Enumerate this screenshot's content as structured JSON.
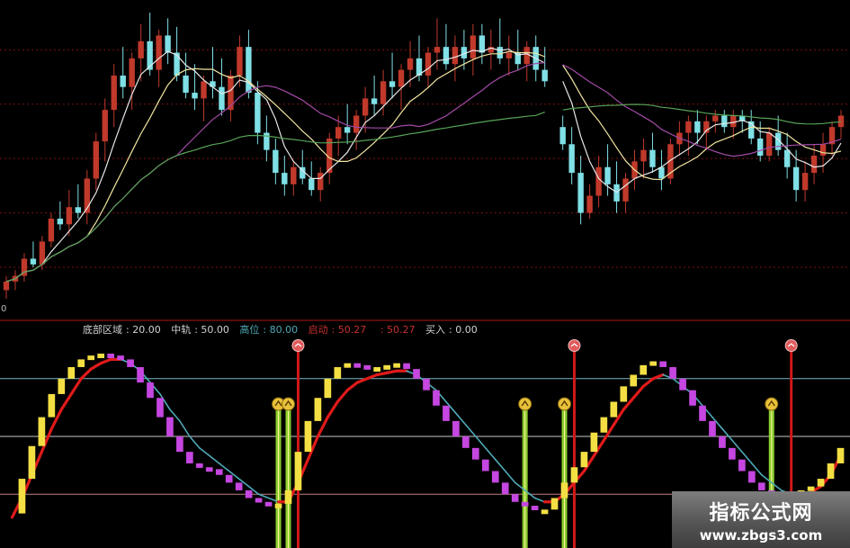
{
  "top_labels": [
    "",
    "",
    ""
  ],
  "axis": {
    "zero_label": "0"
  },
  "legend": [
    {
      "label": "底部区域",
      "value": "20.00",
      "color": "#d2d2d2"
    },
    {
      "label": "中轨",
      "value": "50.00",
      "color": "#d2d2d2"
    },
    {
      "label": "高位",
      "value": "80.00",
      "color": "#4fa9b8"
    },
    {
      "label": "启动",
      "value": "50.27",
      "color": "#c83030"
    },
    {
      "label": "",
      "value": "50.27",
      "color": "#c83030"
    },
    {
      "label": "买入",
      "value": "0.00",
      "color": "#d2d2d2"
    }
  ],
  "watermark": {
    "title": "指标公式网",
    "url": "www.zbgs3.com"
  },
  "colors": {
    "background": "#000000",
    "up_candle": "#c0392b",
    "down_candle": "#7fe0e6",
    "ma5": "#e8e8e8",
    "ma10": "#f1e6a0",
    "ma20": "#a24aa6",
    "ma60": "#56a356",
    "kd_fast_up": "#f3df43",
    "kd_fast_down": "#c546e0",
    "kd_slow_up": "#e01a1a",
    "kd_slow_down": "#4fa9b8",
    "buy_bar": "#8ccc2e",
    "sell_bar": "#d01818",
    "buy_marker": "#e7c23a",
    "sell_marker": "#e05a5a"
  },
  "chart_data": [
    {
      "type": "candlestick",
      "title": "",
      "ylim": [
        0,
        100
      ],
      "note": "Upper panel: daily candles with moving averages; a gap in the data after bar 60.",
      "candles": [
        {
          "o": 3,
          "h": 8,
          "l": 0,
          "c": 6
        },
        {
          "o": 6,
          "h": 10,
          "l": 3,
          "c": 8
        },
        {
          "o": 8,
          "h": 16,
          "l": 6,
          "c": 14
        },
        {
          "o": 14,
          "h": 20,
          "l": 11,
          "c": 12
        },
        {
          "o": 12,
          "h": 22,
          "l": 10,
          "c": 20
        },
        {
          "o": 20,
          "h": 30,
          "l": 18,
          "c": 28
        },
        {
          "o": 28,
          "h": 34,
          "l": 24,
          "c": 26
        },
        {
          "o": 26,
          "h": 38,
          "l": 22,
          "c": 32
        },
        {
          "o": 32,
          "h": 40,
          "l": 28,
          "c": 30
        },
        {
          "o": 30,
          "h": 45,
          "l": 26,
          "c": 42
        },
        {
          "o": 42,
          "h": 58,
          "l": 38,
          "c": 55
        },
        {
          "o": 55,
          "h": 70,
          "l": 48,
          "c": 66
        },
        {
          "o": 66,
          "h": 82,
          "l": 60,
          "c": 78
        },
        {
          "o": 78,
          "h": 88,
          "l": 70,
          "c": 74
        },
        {
          "o": 74,
          "h": 86,
          "l": 66,
          "c": 84
        },
        {
          "o": 84,
          "h": 96,
          "l": 76,
          "c": 90
        },
        {
          "o": 90,
          "h": 100,
          "l": 78,
          "c": 80
        },
        {
          "o": 80,
          "h": 94,
          "l": 74,
          "c": 92
        },
        {
          "o": 92,
          "h": 98,
          "l": 82,
          "c": 86
        },
        {
          "o": 86,
          "h": 95,
          "l": 76,
          "c": 78
        },
        {
          "o": 78,
          "h": 86,
          "l": 70,
          "c": 72
        },
        {
          "o": 72,
          "h": 82,
          "l": 66,
          "c": 70
        },
        {
          "o": 70,
          "h": 78,
          "l": 62,
          "c": 76
        },
        {
          "o": 76,
          "h": 88,
          "l": 70,
          "c": 74
        },
        {
          "o": 74,
          "h": 84,
          "l": 64,
          "c": 66
        },
        {
          "o": 66,
          "h": 80,
          "l": 62,
          "c": 78
        },
        {
          "o": 78,
          "h": 92,
          "l": 74,
          "c": 88
        },
        {
          "o": 88,
          "h": 94,
          "l": 70,
          "c": 72
        },
        {
          "o": 72,
          "h": 76,
          "l": 54,
          "c": 58
        },
        {
          "o": 58,
          "h": 64,
          "l": 48,
          "c": 52
        },
        {
          "o": 52,
          "h": 56,
          "l": 40,
          "c": 44
        },
        {
          "o": 44,
          "h": 50,
          "l": 36,
          "c": 40
        },
        {
          "o": 40,
          "h": 48,
          "l": 36,
          "c": 46
        },
        {
          "o": 46,
          "h": 52,
          "l": 40,
          "c": 42
        },
        {
          "o": 42,
          "h": 48,
          "l": 36,
          "c": 38
        },
        {
          "o": 38,
          "h": 46,
          "l": 34,
          "c": 44
        },
        {
          "o": 44,
          "h": 58,
          "l": 40,
          "c": 56
        },
        {
          "o": 56,
          "h": 64,
          "l": 50,
          "c": 60
        },
        {
          "o": 60,
          "h": 68,
          "l": 54,
          "c": 58
        },
        {
          "o": 58,
          "h": 66,
          "l": 52,
          "c": 64
        },
        {
          "o": 64,
          "h": 74,
          "l": 58,
          "c": 70
        },
        {
          "o": 70,
          "h": 78,
          "l": 64,
          "c": 68
        },
        {
          "o": 68,
          "h": 80,
          "l": 64,
          "c": 76
        },
        {
          "o": 76,
          "h": 86,
          "l": 70,
          "c": 74
        },
        {
          "o": 74,
          "h": 82,
          "l": 66,
          "c": 80
        },
        {
          "o": 80,
          "h": 90,
          "l": 74,
          "c": 84
        },
        {
          "o": 84,
          "h": 92,
          "l": 76,
          "c": 78
        },
        {
          "o": 78,
          "h": 88,
          "l": 74,
          "c": 86
        },
        {
          "o": 86,
          "h": 98,
          "l": 80,
          "c": 88
        },
        {
          "o": 88,
          "h": 96,
          "l": 80,
          "c": 82
        },
        {
          "o": 82,
          "h": 92,
          "l": 76,
          "c": 88
        },
        {
          "o": 88,
          "h": 94,
          "l": 80,
          "c": 84
        },
        {
          "o": 84,
          "h": 96,
          "l": 78,
          "c": 92
        },
        {
          "o": 92,
          "h": 96,
          "l": 82,
          "c": 86
        },
        {
          "o": 86,
          "h": 94,
          "l": 80,
          "c": 88
        },
        {
          "o": 88,
          "h": 98,
          "l": 82,
          "c": 84
        },
        {
          "o": 84,
          "h": 92,
          "l": 78,
          "c": 86
        },
        {
          "o": 86,
          "h": 94,
          "l": 80,
          "c": 82
        },
        {
          "o": 82,
          "h": 90,
          "l": 76,
          "c": 88
        },
        {
          "o": 88,
          "h": 92,
          "l": 76,
          "c": 80
        },
        {
          "o": 80,
          "h": 88,
          "l": 74,
          "c": 76
        },
        {
          "o": 60,
          "h": 64,
          "l": 52,
          "c": 54
        },
        {
          "o": 54,
          "h": 60,
          "l": 40,
          "c": 44
        },
        {
          "o": 44,
          "h": 50,
          "l": 26,
          "c": 30
        },
        {
          "o": 30,
          "h": 40,
          "l": 28,
          "c": 36
        },
        {
          "o": 36,
          "h": 50,
          "l": 32,
          "c": 46
        },
        {
          "o": 46,
          "h": 54,
          "l": 36,
          "c": 40
        },
        {
          "o": 40,
          "h": 48,
          "l": 30,
          "c": 34
        },
        {
          "o": 34,
          "h": 44,
          "l": 30,
          "c": 42
        },
        {
          "o": 42,
          "h": 52,
          "l": 38,
          "c": 48
        },
        {
          "o": 48,
          "h": 56,
          "l": 42,
          "c": 52
        },
        {
          "o": 52,
          "h": 58,
          "l": 44,
          "c": 46
        },
        {
          "o": 46,
          "h": 52,
          "l": 38,
          "c": 42
        },
        {
          "o": 42,
          "h": 56,
          "l": 40,
          "c": 54
        },
        {
          "o": 54,
          "h": 62,
          "l": 50,
          "c": 58
        },
        {
          "o": 58,
          "h": 64,
          "l": 50,
          "c": 62
        },
        {
          "o": 62,
          "h": 66,
          "l": 54,
          "c": 58
        },
        {
          "o": 58,
          "h": 64,
          "l": 52,
          "c": 62
        },
        {
          "o": 62,
          "h": 66,
          "l": 58,
          "c": 64
        },
        {
          "o": 64,
          "h": 66,
          "l": 58,
          "c": 60
        },
        {
          "o": 60,
          "h": 66,
          "l": 56,
          "c": 64
        },
        {
          "o": 64,
          "h": 66,
          "l": 58,
          "c": 62
        },
        {
          "o": 62,
          "h": 66,
          "l": 54,
          "c": 56
        },
        {
          "o": 56,
          "h": 62,
          "l": 48,
          "c": 50
        },
        {
          "o": 50,
          "h": 60,
          "l": 48,
          "c": 58
        },
        {
          "o": 58,
          "h": 64,
          "l": 50,
          "c": 52
        },
        {
          "o": 52,
          "h": 58,
          "l": 42,
          "c": 46
        },
        {
          "o": 46,
          "h": 52,
          "l": 34,
          "c": 38
        },
        {
          "o": 38,
          "h": 48,
          "l": 34,
          "c": 44
        },
        {
          "o": 44,
          "h": 54,
          "l": 40,
          "c": 50
        },
        {
          "o": 50,
          "h": 58,
          "l": 44,
          "c": 54
        },
        {
          "o": 54,
          "h": 62,
          "l": 50,
          "c": 60
        },
        {
          "o": 60,
          "h": 66,
          "l": 56,
          "c": 64
        }
      ]
    },
    {
      "type": "line",
      "title": "",
      "ylim": [
        0,
        100
      ],
      "reference_lines": [
        20,
        50,
        80
      ],
      "note": "Lower panel: fast line drawn as step bars (yellow rising, magenta falling), slow line (red rising, teal falling), buy/sell vertical bars.",
      "series": [
        {
          "values": [
            10,
            28,
            45,
            60,
            72,
            80,
            86,
            90,
            92,
            93,
            92,
            90,
            86,
            78,
            70,
            60,
            50,
            42,
            36,
            34,
            33,
            30,
            26,
            22,
            18,
            16,
            15,
            15,
            22,
            42,
            58,
            70,
            80,
            86,
            88,
            87,
            86,
            86,
            87,
            88,
            85,
            80,
            74,
            66,
            58,
            50,
            44,
            38,
            32,
            26,
            20,
            16,
            14,
            12,
            12,
            18,
            26,
            34,
            42,
            52,
            60,
            68,
            76,
            82,
            87,
            89,
            86,
            80,
            74,
            66,
            58,
            50,
            44,
            38,
            32,
            26,
            22,
            20,
            18,
            20,
            22,
            24,
            28,
            36,
            44
          ]
        },
        {
          "values": [
            8,
            18,
            30,
            42,
            54,
            64,
            72,
            80,
            85,
            88,
            90,
            90,
            88,
            84,
            78,
            72,
            64,
            58,
            50,
            44,
            40,
            36,
            32,
            28,
            24,
            20,
            18,
            16,
            16,
            26,
            38,
            50,
            60,
            68,
            74,
            78,
            80,
            82,
            83,
            84,
            84,
            82,
            78,
            74,
            68,
            62,
            56,
            50,
            44,
            38,
            32,
            26,
            22,
            18,
            16,
            16,
            20,
            26,
            32,
            40,
            48,
            56,
            64,
            70,
            76,
            80,
            82,
            80,
            76,
            72,
            66,
            60,
            54,
            48,
            42,
            36,
            30,
            26,
            22,
            20,
            20,
            21,
            24,
            30,
            40
          ]
        }
      ],
      "buy_signals": [
        27,
        28,
        52,
        56,
        77
      ],
      "sell_signals": [
        29,
        57,
        79
      ]
    }
  ]
}
